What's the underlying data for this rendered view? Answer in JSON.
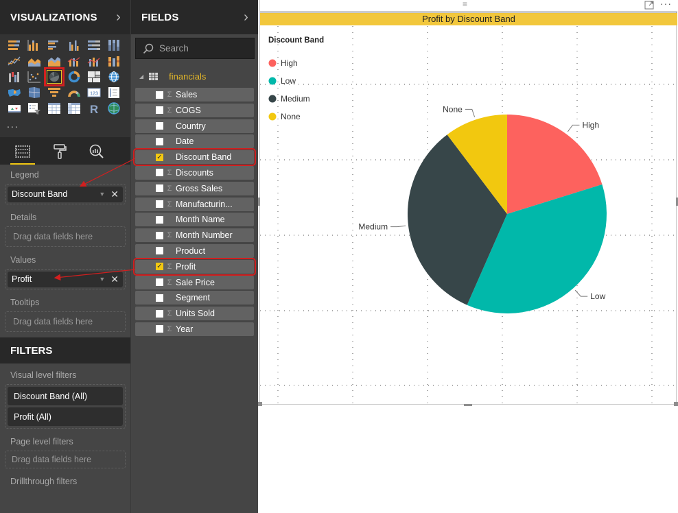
{
  "visualizations_pane": {
    "title": "VISUALIZATIONS",
    "collapse_icon": "chevron-right",
    "gallery_rows": [
      [
        "stacked-bar",
        "stacked-column",
        "clustered-bar",
        "clustered-column",
        "100pct-stacked-bar",
        "100pct-stacked-column"
      ],
      [
        "line",
        "area",
        "stacked-area",
        "line-clustered-column",
        "line-stacked-column",
        "ribbon"
      ],
      [
        "waterfall",
        "scatter",
        "pie",
        "donut",
        "treemap",
        "map"
      ],
      [
        "filled-map",
        "shape-map",
        "funnel",
        "gauge",
        "card",
        "multi-row-card"
      ],
      [
        "kpi",
        "slicer",
        "table",
        "matrix",
        "r-visual",
        "arcgis-globe"
      ]
    ],
    "selected_visual": "pie",
    "more_label": "...",
    "tabs": [
      {
        "name": "fields",
        "icon": "fields-well-icon",
        "active": true
      },
      {
        "name": "format",
        "icon": "paint-roller-icon",
        "active": false
      },
      {
        "name": "analytics",
        "icon": "analytics-icon",
        "active": false
      }
    ],
    "wells": {
      "legend": {
        "label": "Legend",
        "value": "Discount Band"
      },
      "details": {
        "label": "Details",
        "placeholder": "Drag data fields here"
      },
      "values": {
        "label": "Values",
        "value": "Profit"
      },
      "tooltips": {
        "label": "Tooltips",
        "placeholder": "Drag data fields here"
      }
    }
  },
  "filters_pane": {
    "title": "FILTERS",
    "visual_level": {
      "label": "Visual level filters",
      "items": [
        "Discount Band  (All)",
        "Profit  (All)"
      ]
    },
    "page_level": {
      "label": "Page level filters",
      "placeholder": "Drag data fields here"
    },
    "drillthrough": {
      "label": "Drillthrough filters"
    }
  },
  "fields_pane": {
    "title": "FIELDS",
    "collapse_icon": "chevron-right",
    "search_placeholder": "Search",
    "table_name": "financials",
    "fields": [
      {
        "name": "Sales",
        "sigma": true,
        "checked": false
      },
      {
        "name": "COGS",
        "sigma": true,
        "checked": false
      },
      {
        "name": "Country",
        "sigma": false,
        "checked": false
      },
      {
        "name": "Date",
        "sigma": false,
        "checked": false
      },
      {
        "name": "Discount Band",
        "sigma": false,
        "checked": true,
        "highlighted": true
      },
      {
        "name": "Discounts",
        "sigma": true,
        "checked": false
      },
      {
        "name": "Gross Sales",
        "sigma": true,
        "checked": false
      },
      {
        "name": "Manufacturin...",
        "sigma": true,
        "checked": false
      },
      {
        "name": "Month Name",
        "sigma": false,
        "checked": false
      },
      {
        "name": "Month Number",
        "sigma": true,
        "checked": false
      },
      {
        "name": "Product",
        "sigma": false,
        "checked": false
      },
      {
        "name": "Profit",
        "sigma": true,
        "checked": true,
        "highlighted": true
      },
      {
        "name": "Sale Price",
        "sigma": true,
        "checked": false
      },
      {
        "name": "Segment",
        "sigma": false,
        "checked": false
      },
      {
        "name": "Units Sold",
        "sigma": true,
        "checked": false
      },
      {
        "name": "Year",
        "sigma": true,
        "checked": false
      }
    ]
  },
  "visual": {
    "drag_handle": "≡",
    "more_options": "···",
    "accent_color": "#f2c73c",
    "highlight_color": "#d21f1f"
  },
  "chart_data": {
    "type": "pie",
    "title": "Profit by Discount Band",
    "legend_title": "Discount Band",
    "legend_position": "top-left",
    "categories": [
      "High",
      "Low",
      "Medium",
      "None"
    ],
    "values_percent": [
      20.2,
      36.4,
      33.1,
      10.3
    ],
    "colors": [
      "#fd625e",
      "#01b8aa",
      "#374649",
      "#f2c80f"
    ],
    "data_labels": [
      "High",
      "Low",
      "Medium",
      "None"
    ],
    "start_angle": "12 o'clock, clockwise",
    "grid": true
  }
}
